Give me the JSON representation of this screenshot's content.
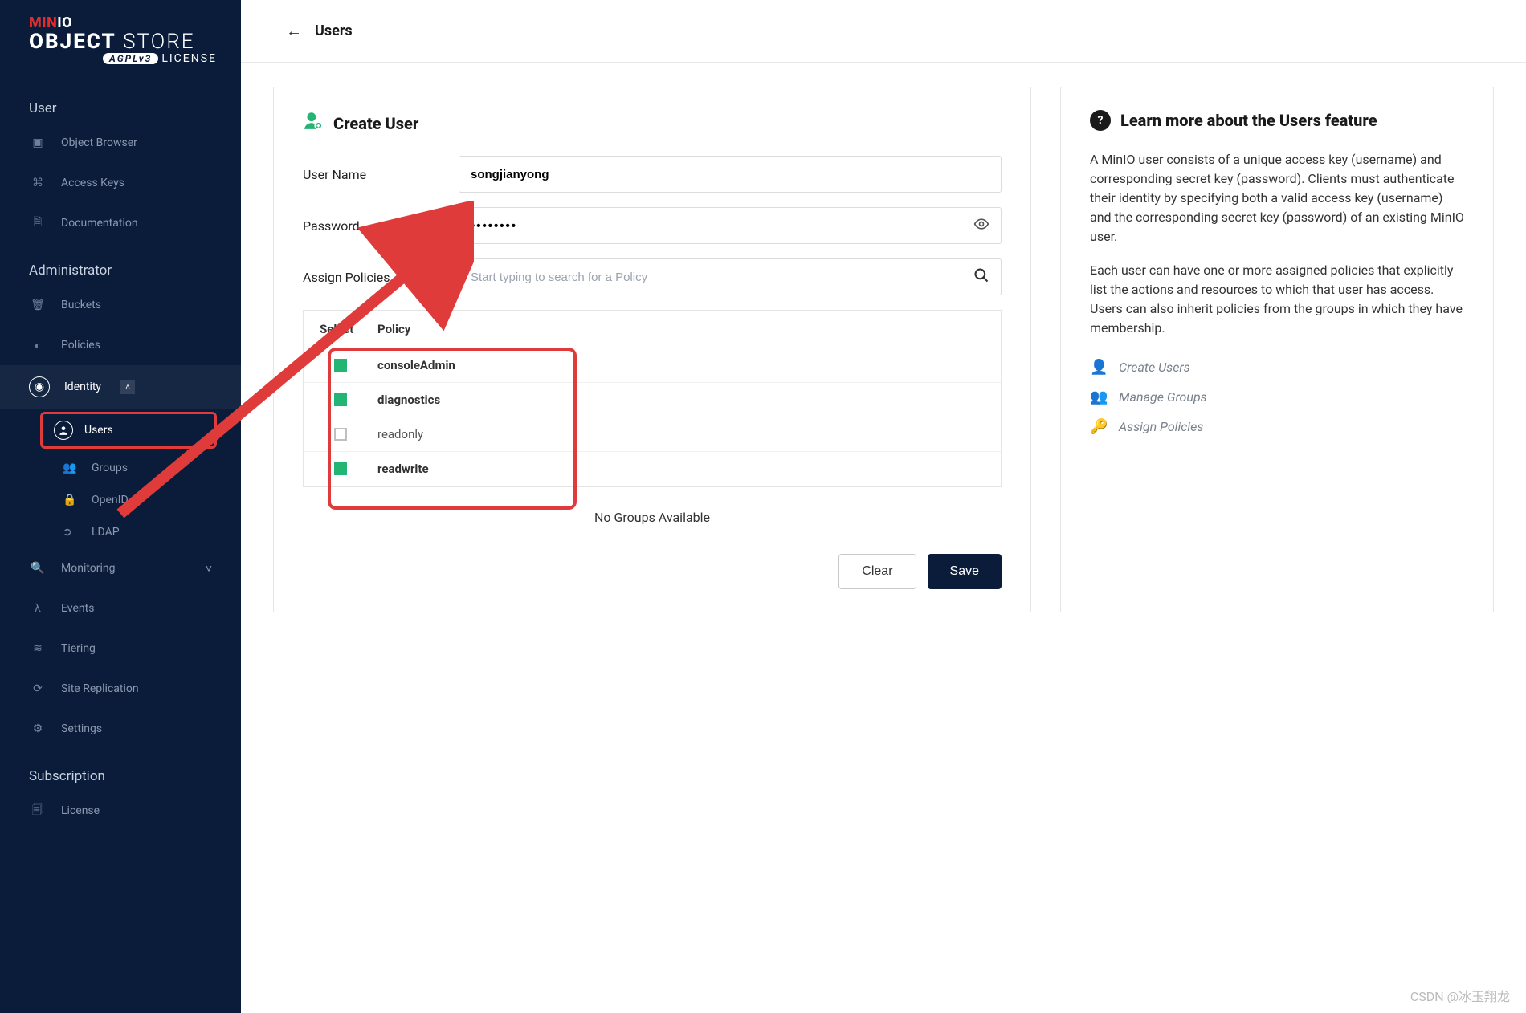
{
  "logo": {
    "minio": "MIN",
    "io": "IO",
    "object": "OBJECT",
    "store": "STORE",
    "license_badge": "AGPLv3",
    "license": "LICENSE"
  },
  "nav": {
    "user_section": "User",
    "items_user": [
      {
        "icon": "cube-icon",
        "label": "Object Browser"
      },
      {
        "icon": "key-icon",
        "label": "Access Keys"
      },
      {
        "icon": "doc-icon",
        "label": "Documentation"
      }
    ],
    "admin_section": "Administrator",
    "buckets": {
      "label": "Buckets"
    },
    "policies": {
      "label": "Policies"
    },
    "identity": {
      "label": "Identity"
    },
    "identity_sub": {
      "users": "Users",
      "groups": "Groups",
      "openid": "OpenID",
      "ldap": "LDAP"
    },
    "monitoring": {
      "label": "Monitoring"
    },
    "events": {
      "label": "Events"
    },
    "tiering": {
      "label": "Tiering"
    },
    "siterep": {
      "label": "Site Replication"
    },
    "settings": {
      "label": "Settings"
    },
    "sub_section": "Subscription",
    "license": {
      "label": "License"
    }
  },
  "topbar": {
    "title": "Users"
  },
  "form": {
    "title": "Create User",
    "username_label": "User Name",
    "username_value": "songjianyong",
    "password_label": "Password",
    "password_value": "••••••••",
    "assign_label": "Assign Policies",
    "policies_placeholder": "Start typing to search for a Policy",
    "policy_header_select": "Select",
    "policy_header_policy": "Policy",
    "policies": [
      {
        "name": "consoleAdmin",
        "checked": true
      },
      {
        "name": "diagnostics",
        "checked": true
      },
      {
        "name": "readonly",
        "checked": false
      },
      {
        "name": "readwrite",
        "checked": true
      }
    ],
    "no_groups": "No Groups Available",
    "clear": "Clear",
    "save": "Save"
  },
  "help": {
    "title": "Learn more about the Users feature",
    "p1": "A MinIO user consists of a unique access key (username) and corresponding secret key (password). Clients must authenticate their identity by specifying both a valid access key (username) and the corresponding secret key (password) of an existing MinIO user.",
    "p2": "Each user can have one or more assigned policies that explicitly list the actions and resources to which that user has access. Users can also inherit policies from the groups in which they have membership.",
    "items": [
      {
        "icon": "user-icon",
        "label": "Create Users"
      },
      {
        "icon": "group-icon",
        "label": "Manage Groups"
      },
      {
        "icon": "key-icon",
        "label": "Assign Policies"
      }
    ]
  },
  "watermark": "CSDN @冰玉翔龙"
}
